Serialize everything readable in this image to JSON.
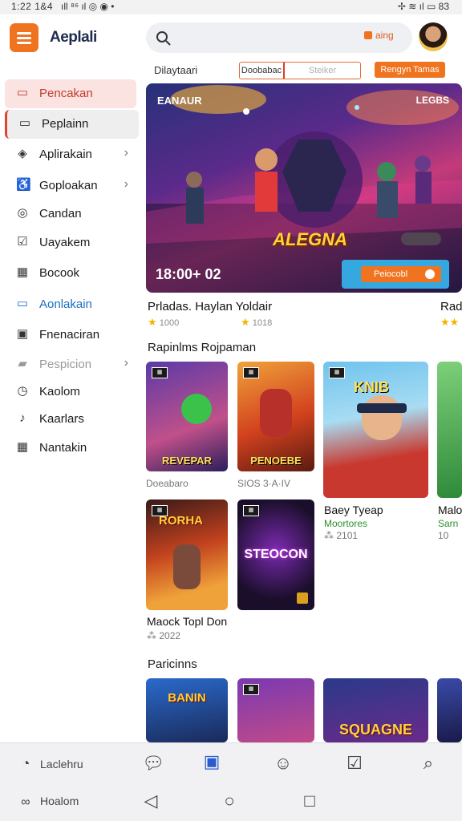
{
  "status_bar": {
    "time": "1:22 1&4",
    "left_icons": "ıll  ⁸⁶ ıl  ◎  ◉  •",
    "right_icons": "✢  ≋  ıl  ▭ 83"
  },
  "header": {
    "app_title": "Aeplali",
    "search_placeholder": "",
    "search_chip": "aing"
  },
  "sidebar": {
    "items": [
      {
        "label": "Pencakan",
        "icon": "tv-icon",
        "glyph": "▭"
      },
      {
        "label": "Peplainn",
        "icon": "monitor-icon",
        "glyph": "▭"
      },
      {
        "label": "Aplirakain",
        "icon": "puzzle-icon",
        "glyph": "◈",
        "chevron": "›"
      },
      {
        "label": "Goploakan",
        "icon": "accessibility-icon",
        "glyph": "♿",
        "chevron": "›"
      },
      {
        "label": "Candan",
        "icon": "circle-icon",
        "glyph": "◎"
      },
      {
        "label": "Uayakem",
        "icon": "checkbox-icon",
        "glyph": "☑"
      },
      {
        "label": "Aonlakain",
        "icon": "square-icon",
        "glyph": "▭"
      },
      {
        "label": "Fnenaciran",
        "icon": "image-icon",
        "glyph": "▣"
      },
      {
        "label": "Pespicion",
        "icon": "chat-icon",
        "glyph": "▰",
        "chevron": "›"
      },
      {
        "label": "Kaolom",
        "icon": "clock-icon",
        "glyph": "◷"
      },
      {
        "label": "Kaarlars",
        "icon": "music-icon",
        "glyph": "♪"
      },
      {
        "label": "Nantakin",
        "icon": "grid-icon",
        "glyph": "▦"
      }
    ],
    "bocook_label": "Bocook"
  },
  "top_bar": {
    "section_label": "Dilaytaari",
    "tabs": [
      "Doobabac",
      "Steiker"
    ],
    "cta": "Rengyn Tamas"
  },
  "hero": {
    "tag_left": "EANAUR",
    "tag_right": "LEGBS",
    "logo": "ALEGNA",
    "time": "18:00+ 02",
    "cta": "Peiocobl"
  },
  "featured": [
    {
      "title": "Prladas. Haylan Yoldair",
      "meta": "1000"
    },
    {
      "title": "",
      "meta": "1018"
    },
    {
      "title": "Rad",
      "meta": ""
    }
  ],
  "sections": {
    "row1": "Rapinlms Rojpaman",
    "row3": "Paricinns"
  },
  "cards": [
    {
      "caption": "REVEPAR",
      "sub": "Doeabaro"
    },
    {
      "caption": "PENOEBE",
      "sub": "SIOS 3·A·IV"
    },
    {
      "caption": "KNIB",
      "title": "Baey Tyeap",
      "genre": "Moortores",
      "meta": "2101"
    },
    {
      "caption": "",
      "title": "Malo",
      "genre": "Sarn",
      "meta": "10"
    },
    {
      "caption": "RORHA",
      "title": "Maock Topl Don",
      "meta": "2022"
    },
    {
      "caption": "STEOCON",
      "title": ""
    },
    {
      "caption": "BANIN"
    },
    {
      "caption": ""
    },
    {
      "caption": "SQUAGNE"
    },
    {
      "caption": ""
    }
  ],
  "bottom_nav": {
    "left_label": "Laclehru",
    "left_icon": "q-icon",
    "second_label": "Hoalom"
  },
  "colors": {
    "accent": "#f07420",
    "active_bg": "#fbe3e1",
    "link": "#1b6ec2"
  }
}
